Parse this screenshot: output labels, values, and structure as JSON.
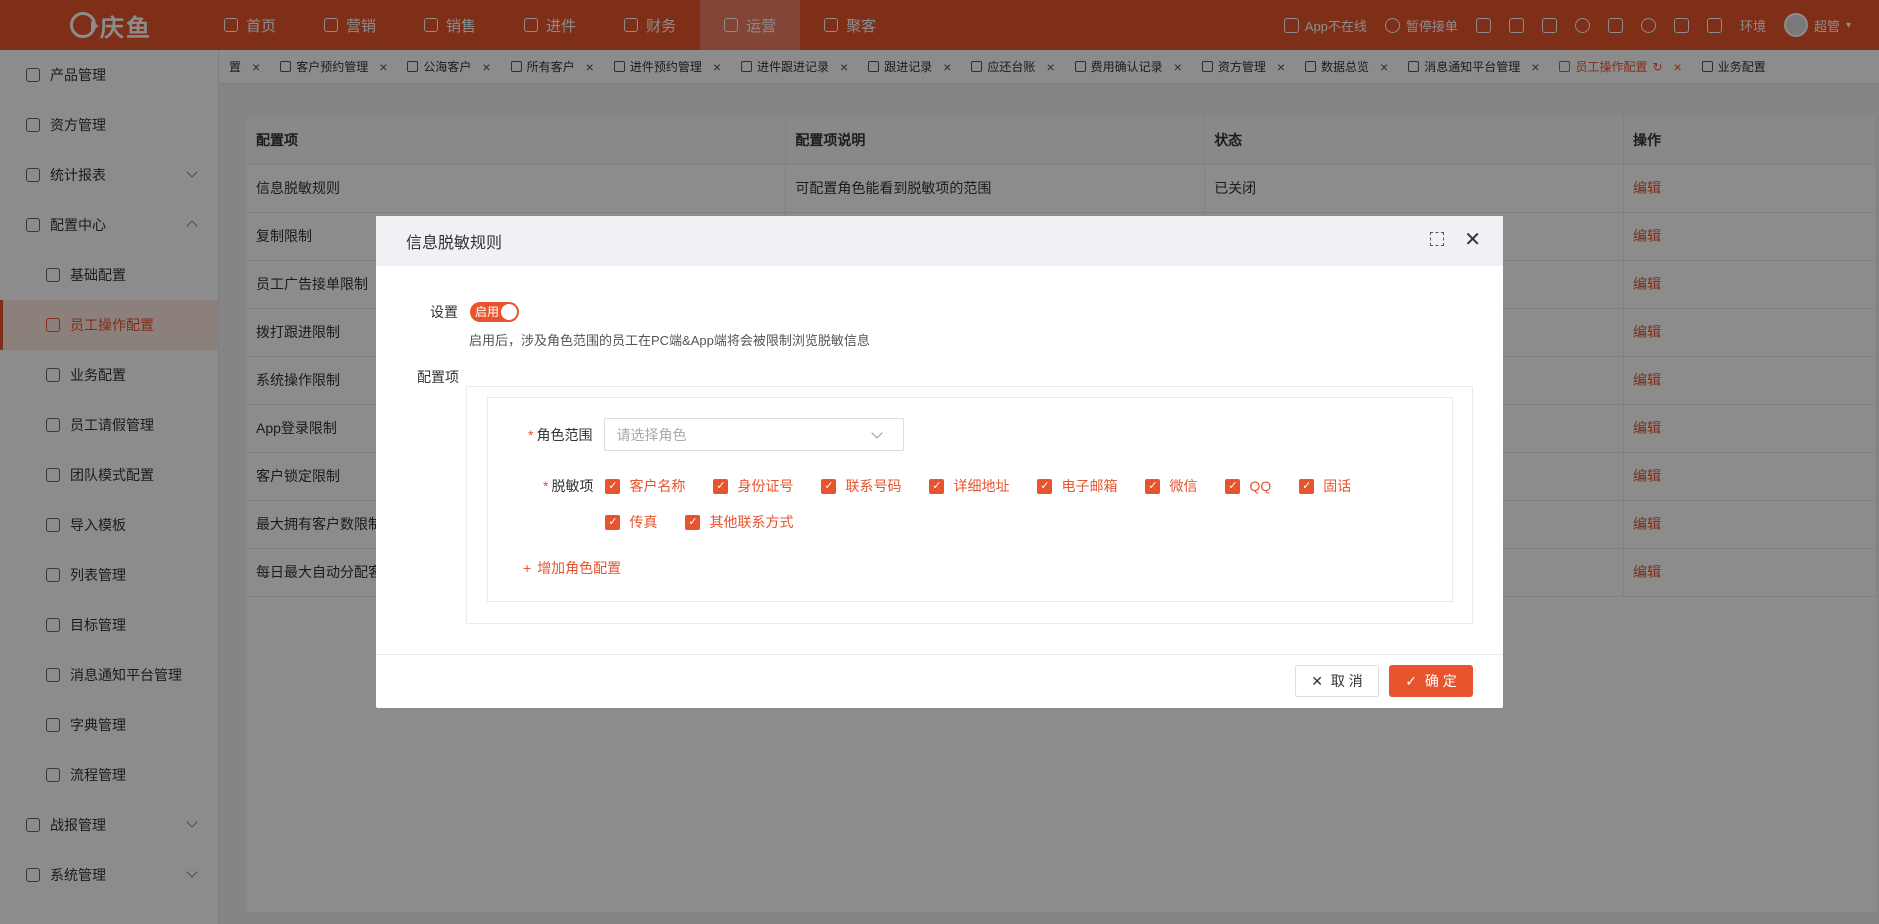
{
  "topbar": {
    "logo": "庆鱼",
    "nav": [
      {
        "label": "首页",
        "icon": "home-icon"
      },
      {
        "label": "营销",
        "icon": "marketing-icon"
      },
      {
        "label": "销售",
        "icon": "sales-icon"
      },
      {
        "label": "进件",
        "icon": "incoming-icon"
      },
      {
        "label": "财务",
        "icon": "finance-icon"
      },
      {
        "label": "运营",
        "icon": "operation-icon",
        "active": true
      },
      {
        "label": "聚客",
        "icon": "customer-gather-icon"
      }
    ],
    "right": {
      "app_status": "App不在线",
      "pause_order": "暂停接单",
      "env": "环境",
      "user": "超管"
    }
  },
  "sidebar": {
    "items": [
      {
        "label": "产品管理",
        "icon": "product-icon"
      },
      {
        "label": "资方管理",
        "icon": "funder-icon"
      },
      {
        "label": "统计报表",
        "icon": "report-icon",
        "expandable": true
      },
      {
        "label": "配置中心",
        "icon": "config-icon",
        "expanded": true
      },
      {
        "label": "基础配置",
        "icon": "basic-config-icon",
        "sub": true
      },
      {
        "label": "员工操作配置",
        "icon": "staff-op-icon",
        "sub": true,
        "active": true
      },
      {
        "label": "业务配置",
        "icon": "business-icon",
        "sub": true
      },
      {
        "label": "员工请假管理",
        "icon": "leave-icon",
        "sub": true
      },
      {
        "label": "团队模式配置",
        "icon": "team-icon",
        "sub": true
      },
      {
        "label": "导入模板",
        "icon": "import-icon",
        "sub": true
      },
      {
        "label": "列表管理",
        "icon": "list-icon",
        "sub": true
      },
      {
        "label": "目标管理",
        "icon": "target-icon",
        "sub": true
      },
      {
        "label": "消息通知平台管理",
        "icon": "message-icon",
        "sub": true
      },
      {
        "label": "字典管理",
        "icon": "dictionary-icon",
        "sub": true
      },
      {
        "label": "流程管理",
        "icon": "flow-icon",
        "sub": true
      },
      {
        "label": "战报管理",
        "icon": "battle-report-icon",
        "expandable": true
      },
      {
        "label": "系统管理",
        "icon": "system-icon",
        "expandable": true
      }
    ]
  },
  "tabs": [
    {
      "label": "置"
    },
    {
      "label": "客户预约管理"
    },
    {
      "label": "公海客户"
    },
    {
      "label": "所有客户"
    },
    {
      "label": "进件预约管理"
    },
    {
      "label": "进件跟进记录"
    },
    {
      "label": "跟进记录"
    },
    {
      "label": "应还台账"
    },
    {
      "label": "费用确认记录"
    },
    {
      "label": "资方管理"
    },
    {
      "label": "数据总览"
    },
    {
      "label": "消息通知平台管理"
    },
    {
      "label": "员工操作配置",
      "active": true
    },
    {
      "label": "业务配置"
    }
  ],
  "table": {
    "headers": [
      "配置项",
      "配置项说明",
      "状态",
      "操作"
    ],
    "rows": [
      {
        "name": "信息脱敏规则",
        "desc": "可配置角色能看到脱敏项的范围",
        "status": "已关闭",
        "action": "编辑"
      },
      {
        "name": "复制限制",
        "desc": "",
        "status": "",
        "action": "编辑"
      },
      {
        "name": "员工广告接单限制",
        "desc": "",
        "status": "",
        "action": "编辑"
      },
      {
        "name": "拨打跟进限制",
        "desc": "",
        "status": "",
        "action": "编辑"
      },
      {
        "name": "系统操作限制",
        "desc": "",
        "status": "",
        "action": "编辑"
      },
      {
        "name": "App登录限制",
        "desc": "",
        "status": "",
        "action": "编辑"
      },
      {
        "name": "客户锁定限制",
        "desc": "",
        "status": "",
        "action": "编辑"
      },
      {
        "name": "最大拥有客户数限制",
        "desc": "",
        "status": "",
        "action": "编辑"
      },
      {
        "name": "每日最大自动分配客",
        "desc": "",
        "status": "",
        "action": "编辑"
      }
    ]
  },
  "modal": {
    "title": "信息脱敏规则",
    "setting_label": "设置",
    "switch_text": "启用",
    "hint": "启用后，涉及角色范围的员工在PC端&App端将会被限制浏览脱敏信息",
    "config_label": "配置项",
    "role_label": "角色范围",
    "role_placeholder": "请选择角色",
    "mask_label": "脱敏项",
    "mask_items": [
      "客户名称",
      "身份证号",
      "联系号码",
      "详细地址",
      "电子邮箱",
      "微信",
      "QQ",
      "固话",
      "传真",
      "其他联系方式"
    ],
    "add_role": "增加角色配置",
    "cancel": "取 消",
    "confirm": "确 定"
  },
  "colors": {
    "accent": "#e8542d"
  }
}
